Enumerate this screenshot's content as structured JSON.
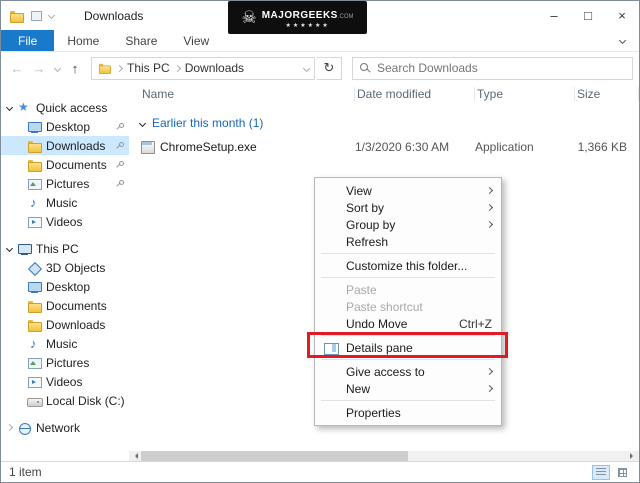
{
  "window": {
    "title": "Downloads",
    "controls": {
      "minimize": "–",
      "maximize": "□",
      "close": "×"
    }
  },
  "watermark": {
    "skull": "☠",
    "brand": "MAJORGEEKS",
    "tld": ".COM",
    "stars": "★★★★★★"
  },
  "ribbon": {
    "tabs": [
      "File",
      "Home",
      "Share",
      "View"
    ]
  },
  "navbar": {
    "back": "←",
    "forward": "→",
    "up": "↑",
    "refresh": "↻",
    "crumbs": [
      "This PC",
      "Downloads"
    ],
    "search_placeholder": "Search Downloads"
  },
  "columns": [
    "Name",
    "Date modified",
    "Type",
    "Size"
  ],
  "sidebar": {
    "quick_access": {
      "label": "Quick access",
      "items": [
        "Desktop",
        "Downloads",
        "Documents",
        "Pictures",
        "Music",
        "Videos"
      ]
    },
    "this_pc": {
      "label": "This PC",
      "items": [
        "3D Objects",
        "Desktop",
        "Documents",
        "Downloads",
        "Music",
        "Pictures",
        "Videos",
        "Local Disk (C:)"
      ]
    },
    "network": {
      "label": "Network"
    }
  },
  "files": {
    "group_label": "Earlier this month (1)",
    "rows": [
      {
        "name": "ChromeSetup.exe",
        "date": "1/3/2020 6:30 AM",
        "type": "Application",
        "size": "1,366 KB"
      }
    ]
  },
  "context_menu": {
    "items": [
      {
        "label": "View",
        "submenu": true
      },
      {
        "label": "Sort by",
        "submenu": true
      },
      {
        "label": "Group by",
        "submenu": true
      },
      {
        "label": "Refresh"
      },
      {
        "separator": true
      },
      {
        "label": "Customize this folder..."
      },
      {
        "separator": true
      },
      {
        "label": "Paste",
        "disabled": true
      },
      {
        "label": "Paste shortcut",
        "disabled": true
      },
      {
        "label": "Undo Move",
        "shortcut": "Ctrl+Z"
      },
      {
        "separator": true
      },
      {
        "label": "Details pane",
        "highlighted": true
      },
      {
        "separator": true
      },
      {
        "label": "Give access to",
        "submenu": true
      },
      {
        "label": "New",
        "submenu": true
      },
      {
        "separator": true
      },
      {
        "label": "Properties"
      }
    ]
  },
  "statusbar": {
    "count": "1 item"
  },
  "colors": {
    "accent_blue": "#1979ca",
    "selection": "#cce8ff",
    "group_header": "#1a66b6",
    "highlight_red": "#e01b24"
  }
}
